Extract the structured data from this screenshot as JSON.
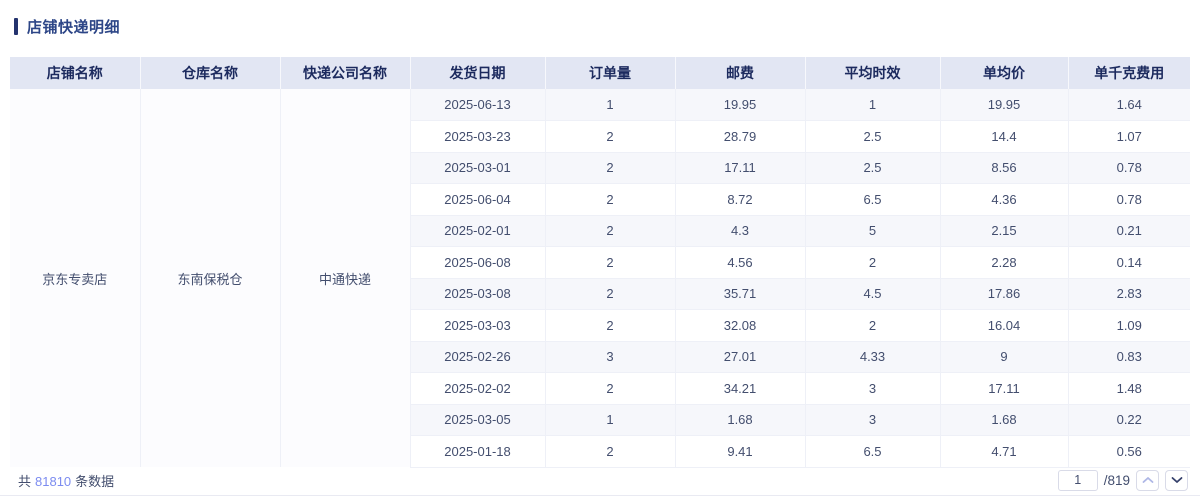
{
  "page": {
    "title": "店铺快递明细"
  },
  "table": {
    "columns": [
      "店铺名称",
      "仓库名称",
      "快递公司名称",
      "发货日期",
      "订单量",
      "邮费",
      "平均时效",
      "单均价",
      "单千克费用"
    ],
    "merged": {
      "shop_name": "京东专卖店",
      "warehouse_name": "东南保税仓",
      "courier_name": "中通快递"
    },
    "rows": [
      [
        "2025-06-13",
        "1",
        "19.95",
        "1",
        "19.95",
        "1.64"
      ],
      [
        "2025-03-23",
        "2",
        "28.79",
        "2.5",
        "14.4",
        "1.07"
      ],
      [
        "2025-03-01",
        "2",
        "17.11",
        "2.5",
        "8.56",
        "0.78"
      ],
      [
        "2025-06-04",
        "2",
        "8.72",
        "6.5",
        "4.36",
        "0.78"
      ],
      [
        "2025-02-01",
        "2",
        "4.3",
        "5",
        "2.15",
        "0.21"
      ],
      [
        "2025-06-08",
        "2",
        "4.56",
        "2",
        "2.28",
        "0.14"
      ],
      [
        "2025-03-08",
        "2",
        "35.71",
        "4.5",
        "17.86",
        "2.83"
      ],
      [
        "2025-03-03",
        "2",
        "32.08",
        "2",
        "16.04",
        "1.09"
      ],
      [
        "2025-02-26",
        "3",
        "27.01",
        "4.33",
        "9",
        "0.83"
      ],
      [
        "2025-02-02",
        "2",
        "34.21",
        "3",
        "17.11",
        "1.48"
      ],
      [
        "2025-03-05",
        "1",
        "1.68",
        "3",
        "1.68",
        "0.22"
      ],
      [
        "2025-01-18",
        "2",
        "9.41",
        "6.5",
        "4.71",
        "0.56"
      ]
    ]
  },
  "footer": {
    "total_prefix": "共",
    "total_count": "81810",
    "total_suffix": "条数据",
    "page_input_value": "1",
    "total_pages": "/819"
  },
  "colors": {
    "accent_bar": "#24336e",
    "title_text": "#2d4687",
    "header_bg": "#e2e6f3",
    "header_text": "#1c2a5e",
    "body_text": "#434e6e",
    "row_alt_bg": "#f6f7fb",
    "merged_bg": "#fcfcfe",
    "grid_line": "#eef0f7",
    "count_link": "#7c8cf0",
    "control_border": "#d9dbe8",
    "chevron_up_disabled": "#aeb7e6",
    "chevron_down": "#35406b"
  }
}
